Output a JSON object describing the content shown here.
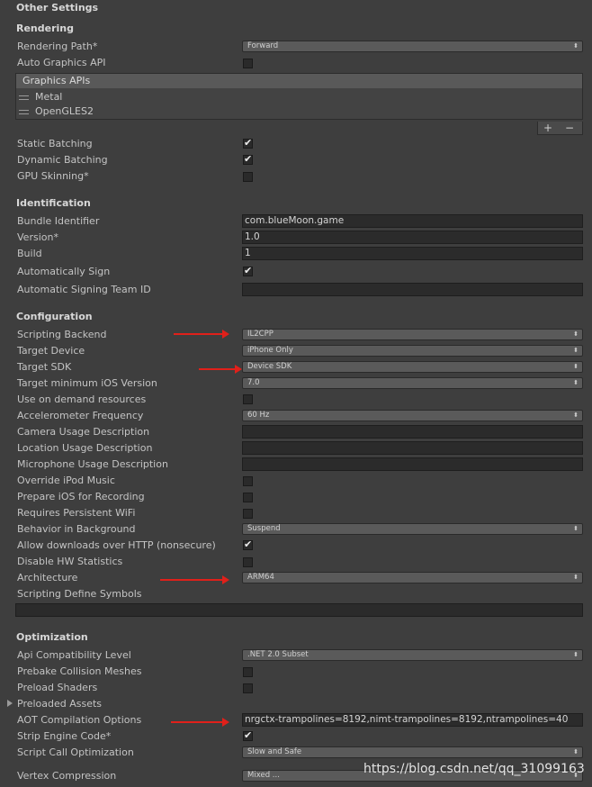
{
  "title": "Other Settings",
  "rendering": {
    "header": "Rendering",
    "rendering_path_label": "Rendering Path*",
    "rendering_path_value": "Forward",
    "auto_graphics_label": "Auto Graphics API",
    "graphics_apis_title": "Graphics APIs",
    "graphics_apis": [
      "Metal",
      "OpenGLES2"
    ],
    "plus": "+",
    "minus": "−",
    "static_batching_label": "Static Batching",
    "dynamic_batching_label": "Dynamic Batching",
    "gpu_skinning_label": "GPU Skinning*"
  },
  "identification": {
    "header": "Identification",
    "bundle_label": "Bundle Identifier",
    "bundle_value": "com.blueMoon.game",
    "version_label": "Version*",
    "version_value": "1.0",
    "build_label": "Build",
    "build_value": "1",
    "auto_sign_label": "Automatically Sign",
    "team_id_label": "Automatic Signing Team ID",
    "team_id_value": ""
  },
  "configuration": {
    "header": "Configuration",
    "scripting_backend_label": "Scripting Backend",
    "scripting_backend_value": "IL2CPP",
    "target_device_label": "Target Device",
    "target_device_value": "iPhone Only",
    "target_sdk_label": "Target SDK",
    "target_sdk_value": "Device SDK",
    "min_ios_label": "Target minimum iOS Version",
    "min_ios_value": "7.0",
    "on_demand_label": "Use on demand resources",
    "accel_label": "Accelerometer Frequency",
    "accel_value": "60 Hz",
    "camera_label": "Camera Usage Description",
    "location_label": "Location Usage Description",
    "mic_label": "Microphone Usage Description",
    "ipod_label": "Override iPod Music",
    "recording_label": "Prepare iOS for Recording",
    "wifi_label": "Requires Persistent WiFi",
    "background_label": "Behavior in Background",
    "background_value": "Suspend",
    "http_label": "Allow downloads over HTTP (nonsecure)",
    "hw_stats_label": "Disable HW Statistics",
    "arch_label": "Architecture",
    "arch_value": "ARM64",
    "define_symbols_label": "Scripting Define Symbols"
  },
  "optimization": {
    "header": "Optimization",
    "api_label": "Api Compatibility Level",
    "api_value": ".NET 2.0 Subset",
    "prebake_label": "Prebake Collision Meshes",
    "preload_shaders_label": "Preload Shaders",
    "preloaded_assets_label": "Preloaded Assets",
    "aot_label": "AOT Compilation Options",
    "aot_value": "nrgctx-trampolines=8192,nimt-trampolines=8192,ntrampolines=40",
    "strip_label": "Strip Engine Code*",
    "script_call_label": "Script Call Optimization",
    "script_call_value": "Slow and Safe",
    "vertex_label": "Vertex Compression",
    "vertex_value": "Mixed ..."
  },
  "checkboxes": {
    "auto_graphics": false,
    "static_batching": true,
    "dynamic_batching": true,
    "gpu_skinning": false,
    "auto_sign": true,
    "on_demand": false,
    "ipod": false,
    "recording": false,
    "wifi": false,
    "http": true,
    "hw_stats": false,
    "prebake": false,
    "preload_shaders": false,
    "strip": true
  },
  "icons": {
    "dropdown": "up-down-arrows-icon",
    "check": "checkmark-icon",
    "annotation": "red-arrow-icon"
  },
  "colors": {
    "background": "#3e3e3e",
    "arrow": "#e0201a",
    "field": "#2b2b2b"
  },
  "watermark": "https://blog.csdn.net/qq_31099163"
}
